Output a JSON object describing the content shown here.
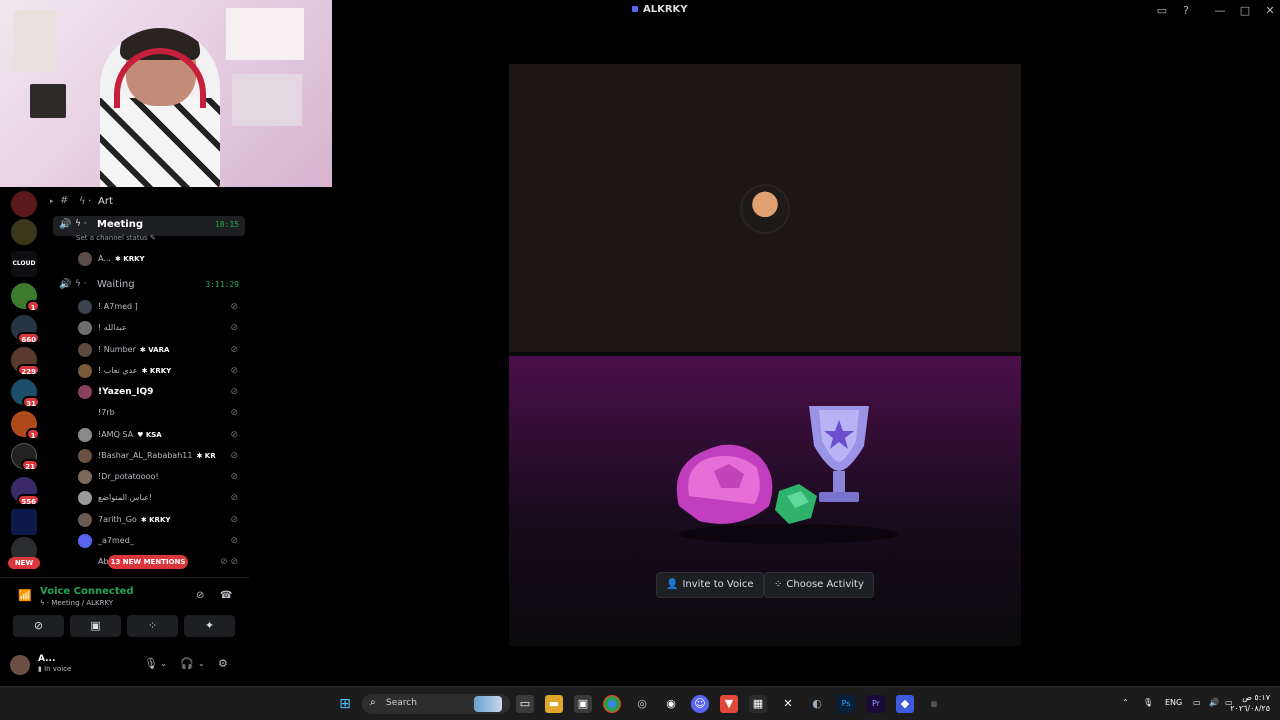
{
  "window": {
    "title": "ALKRKY",
    "buttons": {
      "inbox": "▭",
      "help": "?",
      "minimize": "—",
      "maximize": "□",
      "close": "✕"
    }
  },
  "rail": {
    "badges": [
      "1",
      "660",
      "229",
      "31",
      "1",
      "21",
      "556"
    ],
    "new_label": "NEW",
    "cloud_label": "CLOUD"
  },
  "channels": {
    "category": "Art",
    "meeting": {
      "name": "Meeting",
      "time": "18:15",
      "status_placeholder": "Set a channel status",
      "members": [
        {
          "name": "A...",
          "tag": "KRKY"
        }
      ]
    },
    "waiting": {
      "name": "Waiting",
      "time": "3:11:29",
      "members": [
        {
          "name": "! A7med ]",
          "tag": ""
        },
        {
          "name": "! عبدالله",
          "tag": ""
        },
        {
          "name": "! Number",
          "tag": "VARA"
        },
        {
          "name": "! عدي نعاب",
          "tag": "KRKY"
        },
        {
          "name": "!Yazen_IQ9",
          "tag": ""
        },
        {
          "name": "!7rb",
          "tag": ""
        },
        {
          "name": "!AMQ SA",
          "tag": "KSA"
        },
        {
          "name": "!Bashar_AL_Rababah11",
          "tag": "KR"
        },
        {
          "name": "!Dr_potatoooo!",
          "tag": ""
        },
        {
          "name": "عباس المتواضع!",
          "tag": ""
        },
        {
          "name": "7arith_Go",
          "tag": "KRKY"
        },
        {
          "name": "_a7med_",
          "tag": ""
        },
        {
          "name": "Ab",
          "tag": ""
        }
      ]
    },
    "mentions_label": "13 NEW MENTIONS"
  },
  "voice": {
    "status": "Voice Connected",
    "location": "Meeting / ALKRKY",
    "user_name": "A...",
    "user_status": "In voice"
  },
  "stage": {
    "invite_label": "Invite to Voice",
    "activity_label": "Choose Activity"
  },
  "taskbar": {
    "search_placeholder": "Search",
    "lang": "ENG",
    "time": "٥:١٧ ص",
    "date": "٢٠٢٦/٠٨/٢٥"
  },
  "colors": {
    "green": "#23a559",
    "red": "#da373c",
    "blurple": "#5865f2"
  }
}
